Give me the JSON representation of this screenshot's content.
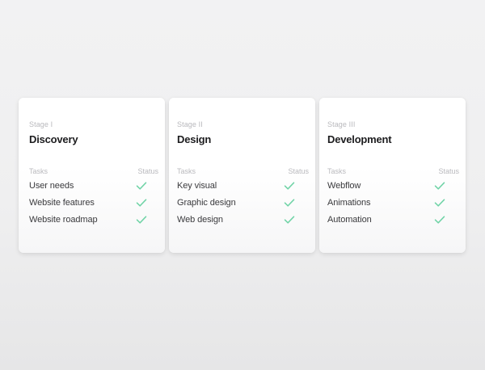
{
  "stages": [
    {
      "stage_label": "Stage I",
      "title": "Discovery",
      "tasks_header": "Tasks",
      "status_header": "Status",
      "tasks": [
        "User needs",
        "Website features",
        "Website roadmap"
      ]
    },
    {
      "stage_label": "Stage II",
      "title": "Design",
      "tasks_header": "Tasks",
      "status_header": "Status",
      "tasks": [
        "Key visual",
        "Graphic design",
        "Web design"
      ]
    },
    {
      "stage_label": "Stage III",
      "title": "Development",
      "tasks_header": "Tasks",
      "status_header": "Status",
      "tasks": [
        "Webflow",
        "Animations",
        "Automation"
      ]
    }
  ],
  "colors": {
    "check": "#6fd3a6",
    "title": "#1d1d1f",
    "muted": "#b9b9bd"
  },
  "icons": {
    "status": "check-icon"
  }
}
